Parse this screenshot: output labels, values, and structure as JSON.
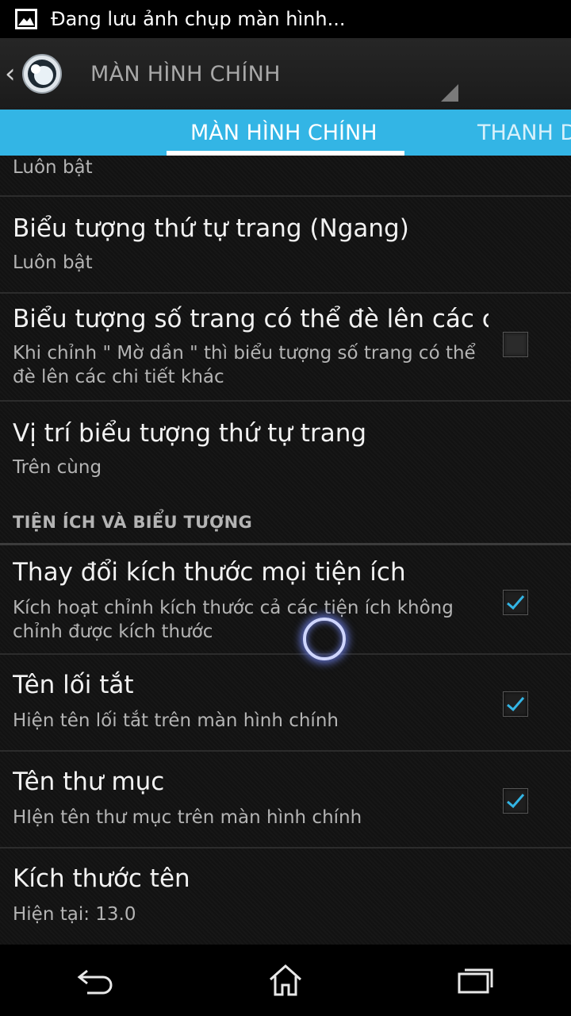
{
  "status_bar": {
    "notification_icon": "image-icon",
    "text": "Đang lưu ảnh chụp màn hình..."
  },
  "action_bar": {
    "back_icon": "chevron-left-icon",
    "title": "MÀN HÌNH CHÍNH"
  },
  "tabs": [
    {
      "label": "MÀN HÌNH CHÍNH",
      "selected": true
    },
    {
      "label": "THANH D"
    }
  ],
  "list": {
    "partial_top": {
      "summary": "Luôn bật"
    },
    "rows": [
      {
        "title": "Biểu tượng thứ tự trang (Ngang)",
        "summary": "Luôn bật"
      },
      {
        "title": "Biểu tượng số trang có thể đè lên các c",
        "summary": "Khi chỉnh \" Mờ dần \" thì biểu tượng số trang có thể đè lên các chi tiết khác",
        "checked": false
      },
      {
        "title": "Vị trí biểu tượng thứ tự trang",
        "summary": "Trên cùng"
      }
    ],
    "section_header": "TIỆN ÍCH VÀ BIỂU TƯỢNG",
    "section_rows": [
      {
        "title": "Thay đổi kích thước mọi tiện ích",
        "summary": "Kích hoạt chỉnh kích thước cả các tiện ích không chỉnh được kích thước",
        "checked": true
      },
      {
        "title": "Tên lối tắt",
        "summary": "Hiện tên lối tắt trên màn hình chính",
        "checked": true
      },
      {
        "title": "Tên thư mục",
        "summary": "HIện tên thư mục trên màn hình chính",
        "checked": true
      },
      {
        "title": "Kích thước tên",
        "summary": "Hiện tại: 13.0"
      }
    ]
  },
  "nav_bar": {
    "back_icon": "back-icon",
    "home_icon": "home-icon",
    "recents_icon": "recents-icon"
  },
  "colors": {
    "accent": "#33b5e5",
    "check": "#33b5e5"
  }
}
